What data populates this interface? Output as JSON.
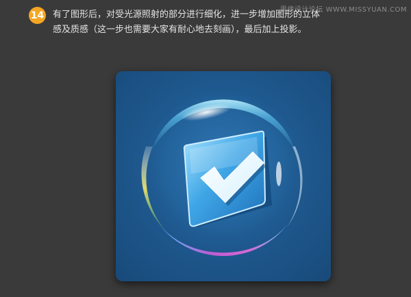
{
  "watermark": "思缘设计论坛 WWW.MISSYUAN.COM",
  "step": {
    "number": "14",
    "description": "有了图形后，对受光源照射的部分进行细化，进一步增加图形的立体感及质感（这一步也需要大家有耐心地去刻画），最后加上投影。"
  },
  "colors": {
    "page_background": "#3a3a3a",
    "badge": "#f5a623",
    "text": "#e4e4e4",
    "tile": "#1f5a90"
  },
  "icon": {
    "name": "checkmark-in-bubble-icon"
  }
}
